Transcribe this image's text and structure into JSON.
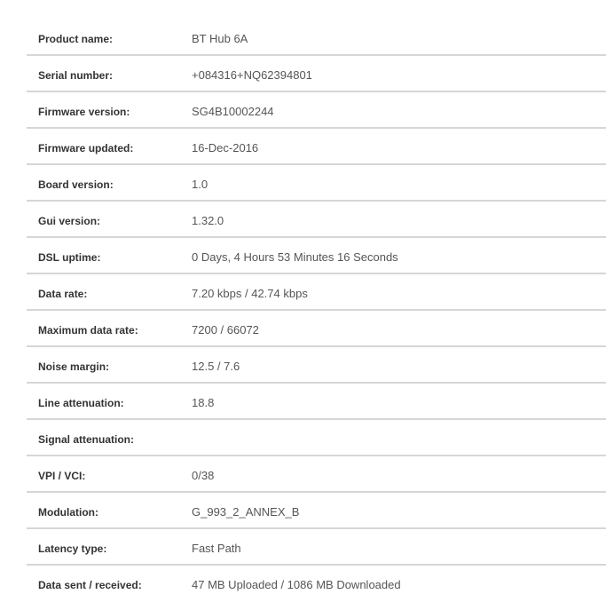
{
  "rows": [
    {
      "label": "Product name:",
      "value": "BT Hub 6A"
    },
    {
      "label": "Serial number:",
      "value": "+084316+NQ62394801"
    },
    {
      "label": "Firmware version:",
      "value": "SG4B10002244"
    },
    {
      "label": "Firmware updated:",
      "value": "16-Dec-2016"
    },
    {
      "label": "Board version:",
      "value": "1.0"
    },
    {
      "label": "Gui version:",
      "value": "1.32.0"
    },
    {
      "label": "DSL uptime:",
      "value": "0 Days, 4 Hours 53 Minutes 16 Seconds"
    },
    {
      "label": "Data rate:",
      "value": "7.20 kbps / 42.74 kbps"
    },
    {
      "label": "Maximum data rate:",
      "value": "7200 / 66072"
    },
    {
      "label": "Noise margin:",
      "value": "12.5 / 7.6"
    },
    {
      "label": "Line attenuation:",
      "value": "18.8"
    },
    {
      "label": "Signal attenuation:",
      "value": ""
    },
    {
      "label": "VPI / VCI:",
      "value": "0/38"
    },
    {
      "label": "Modulation:",
      "value": "G_993_2_ANNEX_B"
    },
    {
      "label": "Latency type:",
      "value": "Fast Path"
    },
    {
      "label": "Data sent / received:",
      "value": "47 MB Uploaded / 1086 MB Downloaded"
    }
  ]
}
